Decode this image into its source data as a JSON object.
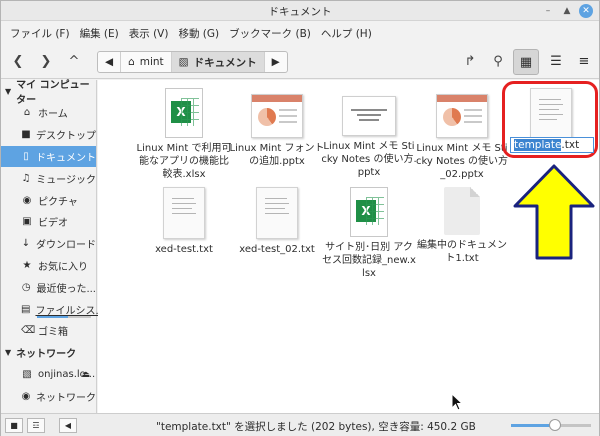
{
  "window": {
    "title": "ドキュメント"
  },
  "menubar": [
    "ファイル (F)",
    "編集 (E)",
    "表示 (V)",
    "移動 (G)",
    "ブックマーク (B)",
    "ヘルプ (H)"
  ],
  "path": {
    "parent": "mint",
    "current": "ドキュメント"
  },
  "sidebar": {
    "computer_header": "マイ コンピューター",
    "items": [
      {
        "label": "ホーム",
        "icon": "home-icon"
      },
      {
        "label": "デスクトップ",
        "icon": "desktop-icon"
      },
      {
        "label": "ドキュメント",
        "icon": "document-icon",
        "active": true
      },
      {
        "label": "ミュージック",
        "icon": "music-icon"
      },
      {
        "label": "ピクチャ",
        "icon": "camera-icon"
      },
      {
        "label": "ビデオ",
        "icon": "video-icon"
      },
      {
        "label": "ダウンロード",
        "icon": "download-icon"
      },
      {
        "label": "お気に入り",
        "icon": "star-icon"
      },
      {
        "label": "最近使った...",
        "icon": "clock-icon"
      },
      {
        "label": "ファイルシス...",
        "icon": "drive-icon",
        "usage": 0.58
      },
      {
        "label": "ゴミ箱",
        "icon": "trash-icon"
      }
    ],
    "network_header": "ネットワーク",
    "network_items": [
      {
        "label": "onjinas.lo...",
        "icon": "folder-icon",
        "eject": true
      },
      {
        "label": "ネットワーク",
        "icon": "network-icon"
      }
    ]
  },
  "files": [
    {
      "name": "Linux Mint で利用可能なアプリの機能比較表.xlsx",
      "kind": "xlsx"
    },
    {
      "name": "Linux Mint フォントの追加.pptx",
      "kind": "pptx"
    },
    {
      "name": "Linux Mint メモ Sticky Notes の使い方.pptx",
      "kind": "pptx-text"
    },
    {
      "name": "Linux Mint メモ Sticky Notes の使い方_02.pptx",
      "kind": "pptx"
    },
    {
      "name": "template.txt",
      "kind": "txt",
      "renaming": true
    },
    {
      "name": "xed-test.txt",
      "kind": "txt"
    },
    {
      "name": "xed-test_02.txt",
      "kind": "txt"
    },
    {
      "name": "サイト別･日別 アクセス回数記録_new.xlsx",
      "kind": "xlsx"
    },
    {
      "name": "編集中のドキュメント1.txt",
      "kind": "blank"
    }
  ],
  "rename": {
    "selected": "template",
    "rest": ".txt"
  },
  "statusbar": {
    "text": "\"template.txt\" を選択しました (202 bytes), 空き容量: 450.2 GB",
    "zoom_level": 0.55
  }
}
